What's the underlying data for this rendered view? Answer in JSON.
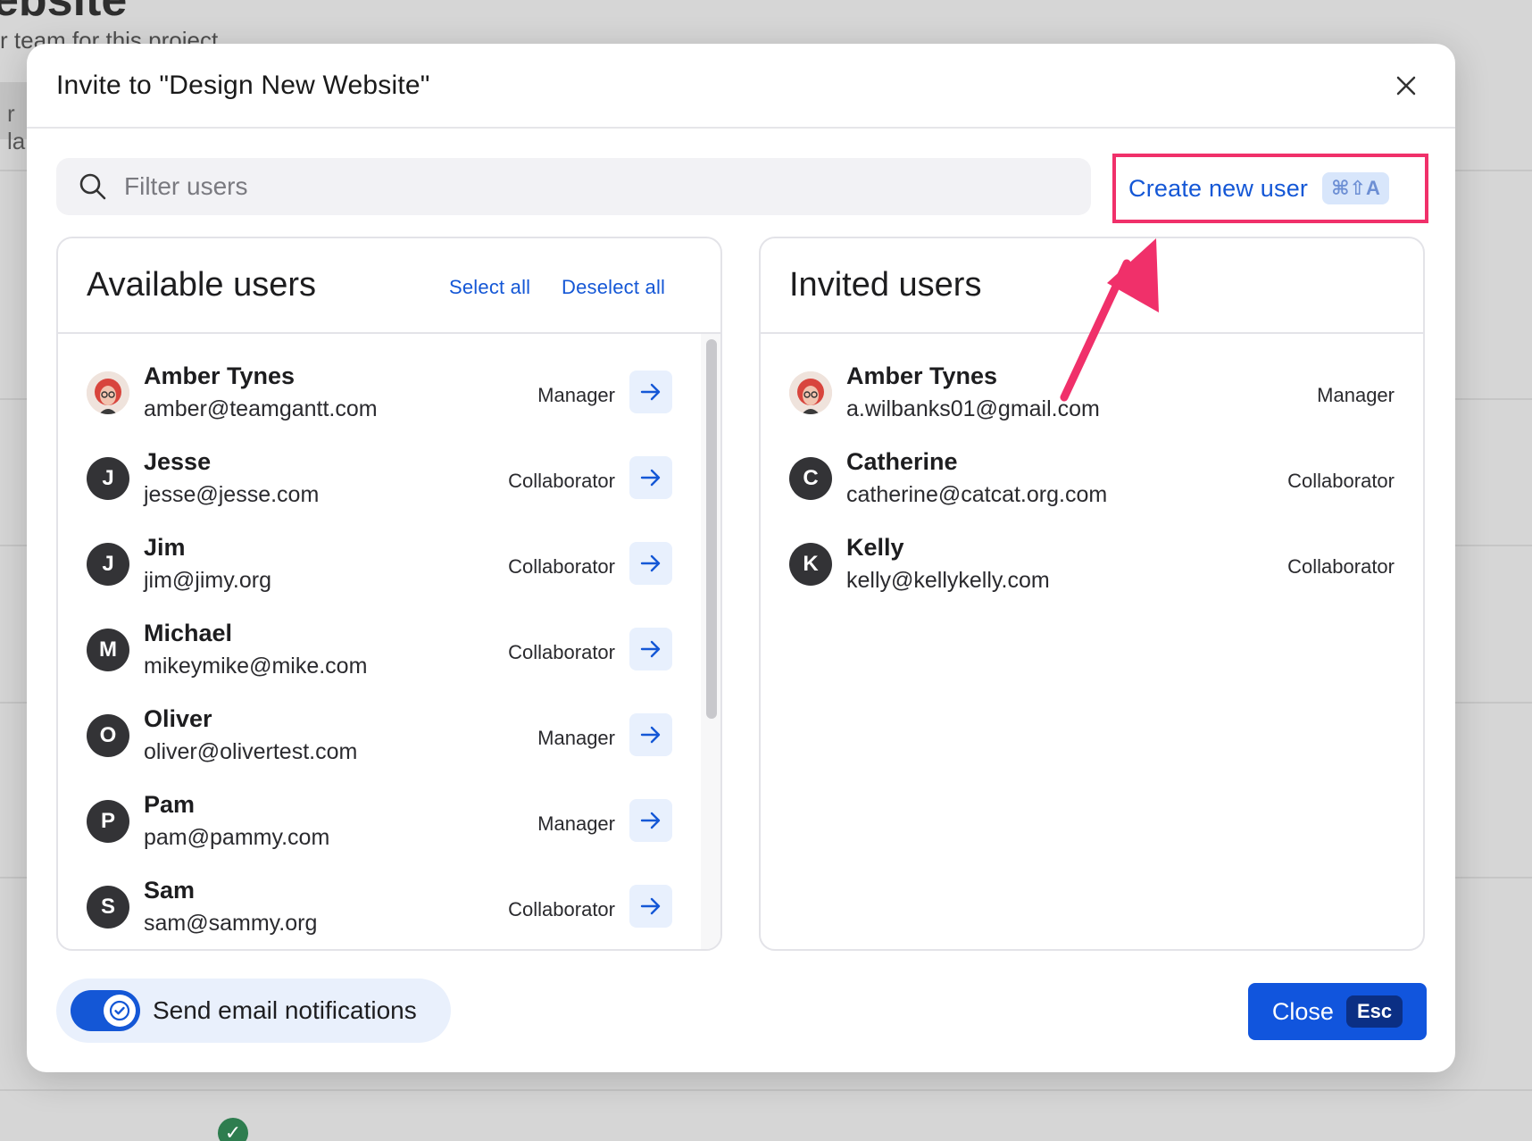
{
  "background": {
    "title_fragment": "ebsite",
    "subtitle_fragment": "r team for this project",
    "strip_fragment": "r la"
  },
  "modal": {
    "title": "Invite to \"Design New Website\"",
    "close_icon": "close-x-icon"
  },
  "search": {
    "placeholder": "Filter users",
    "icon": "search-icon"
  },
  "create_user": {
    "label": "Create new user",
    "shortcut": "⌘⇧A",
    "highlight_color": "#f0306a"
  },
  "available": {
    "title": "Available users",
    "select_all": "Select all",
    "deselect_all": "Deselect all",
    "users": [
      {
        "initial": "",
        "photo": true,
        "name": "Amber Tynes",
        "email": "amber@teamgantt.com",
        "role": "Manager"
      },
      {
        "initial": "J",
        "photo": false,
        "name": "Jesse",
        "email": "jesse@jesse.com",
        "role": "Collaborator"
      },
      {
        "initial": "J",
        "photo": false,
        "name": "Jim",
        "email": "jim@jimy.org",
        "role": "Collaborator"
      },
      {
        "initial": "M",
        "photo": false,
        "name": "Michael",
        "email": "mikeymike@mike.com",
        "role": "Collaborator"
      },
      {
        "initial": "O",
        "photo": false,
        "name": "Oliver",
        "email": "oliver@olivertest.com",
        "role": "Manager"
      },
      {
        "initial": "P",
        "photo": false,
        "name": "Pam",
        "email": "pam@pammy.com",
        "role": "Manager"
      },
      {
        "initial": "S",
        "photo": false,
        "name": "Sam",
        "email": "sam@sammy.org",
        "role": "Collaborator"
      }
    ]
  },
  "invited": {
    "title": "Invited users",
    "users": [
      {
        "initial": "",
        "photo": true,
        "name": "Amber Tynes",
        "email": "a.wilbanks01@gmail.com",
        "role": "Manager"
      },
      {
        "initial": "C",
        "photo": false,
        "name": "Catherine",
        "email": "catherine@catcat.org.com",
        "role": "Collaborator"
      },
      {
        "initial": "K",
        "photo": false,
        "name": "Kelly",
        "email": "kelly@kellykelly.com",
        "role": "Collaborator"
      }
    ]
  },
  "footer": {
    "notifications_label": "Send email notifications",
    "notifications_on": true,
    "close_label": "Close",
    "close_shortcut": "Esc"
  },
  "colors": {
    "accent": "#1457d6",
    "primary_button": "#1155dd",
    "annotation": "#f0306a"
  }
}
